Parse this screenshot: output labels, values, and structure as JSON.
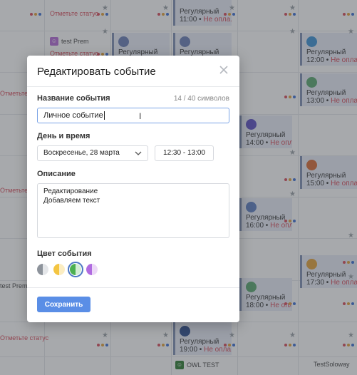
{
  "calendar": {
    "status_link": "Отметьте статус",
    "student_prem": "test Prem",
    "student_prem_cut": "test Prem",
    "owl_label": "OWL TEST",
    "soloway_label": "TestSoloway",
    "event_type": "Регулярный",
    "unpaid_label": "Не опла...",
    "events": [
      {
        "time": "11:00",
        "color": "#6a7fb6"
      },
      {
        "time": "12:00",
        "color": "#3d93d6"
      },
      {
        "time": "13:00",
        "color": "#5aa86f"
      },
      {
        "time": "14:00",
        "color": "#5b4fc4"
      },
      {
        "time": "15:00",
        "color": "#d96a33"
      },
      {
        "time": "16:00",
        "color": "#5d7fc2"
      },
      {
        "time": "17:30",
        "color": "#e3a23a"
      },
      {
        "time": "18:00",
        "color": "#5aa86f"
      },
      {
        "time": "19:00",
        "color": "#2c4e8f"
      }
    ]
  },
  "modal": {
    "title": "Редактировать событие",
    "name_label": "Название события",
    "char_counter": "14 / 40 символов",
    "name_value": "Личное событие",
    "datetime_label": "День и время",
    "date_value": "Воскресенье, 28 марта",
    "time_value": "12:30 - 13:00",
    "description_label": "Описание",
    "description_lines": [
      "Редактирование",
      "Добавляем текст"
    ],
    "color_label": "Цвет события",
    "colors": [
      {
        "name": "gray",
        "fill": "#8d939b"
      },
      {
        "name": "yellow",
        "fill": "#f4c542"
      },
      {
        "name": "green",
        "fill": "#4caf50",
        "selected": true
      },
      {
        "name": "purple",
        "fill": "#b06be0"
      }
    ],
    "save_label": "Сохранить"
  }
}
